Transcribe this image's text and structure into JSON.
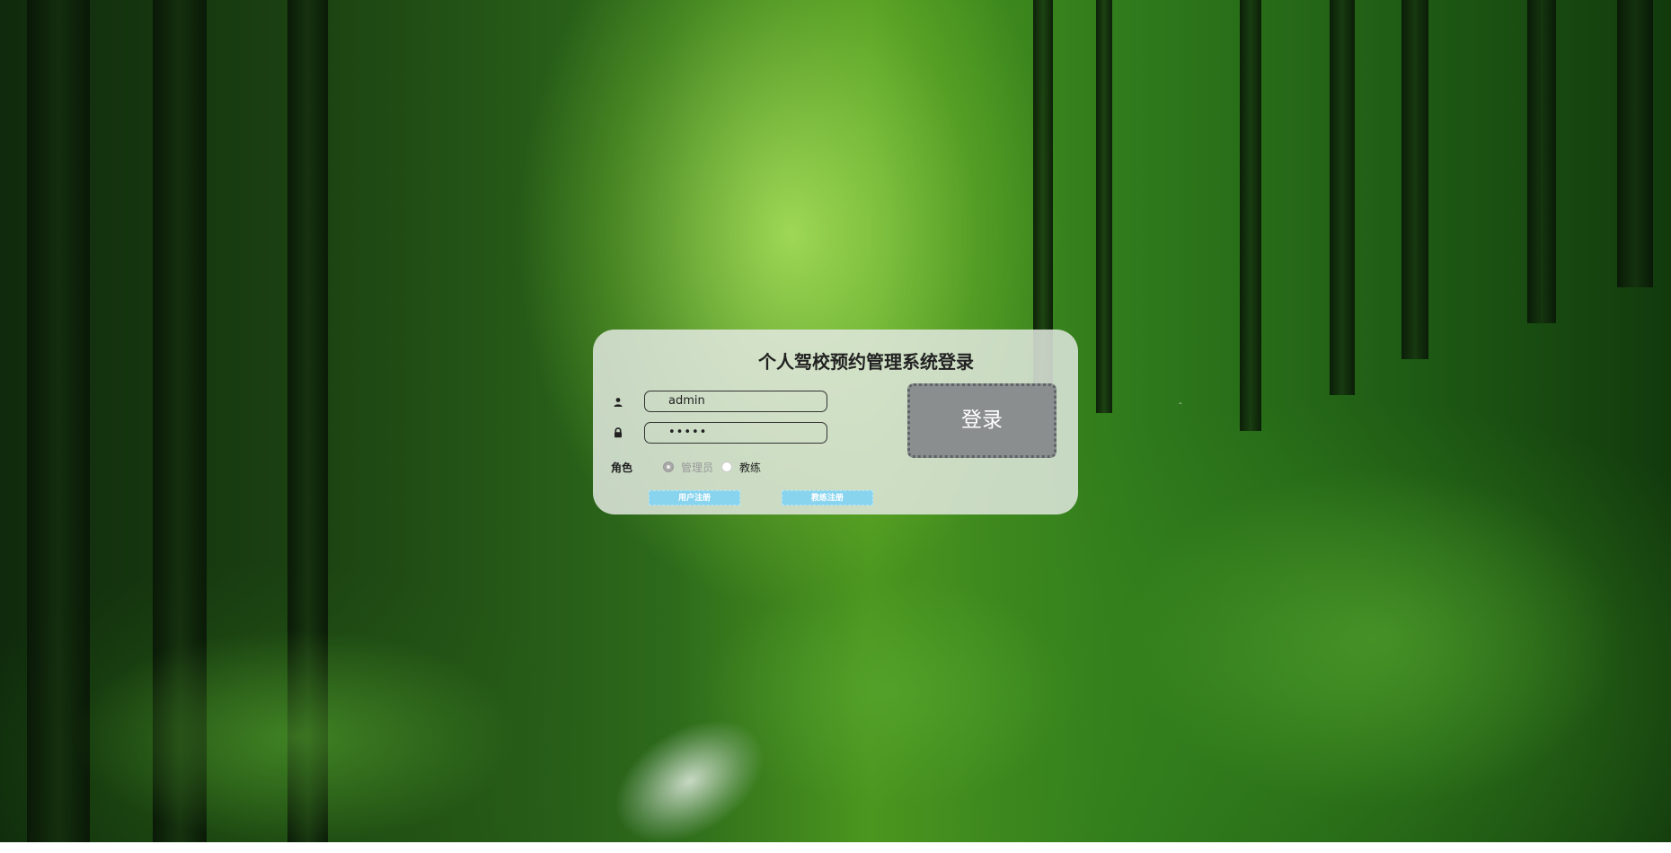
{
  "login": {
    "title": "个人驾校预约管理系统登录",
    "username_value": "admin",
    "password_value": "•••••",
    "role_label": "角色",
    "role_options": [
      "管理员",
      "教练"
    ],
    "role_selected": "管理员",
    "user_register_label": "用户注册",
    "coach_register_label": "教练注册",
    "login_button_label": "登录"
  },
  "background": {
    "mark_text": "-"
  },
  "icons": {
    "username": "user-icon",
    "password": "lock-icon"
  },
  "colors": {
    "panel_bg": "#e1e8de",
    "login_button": "#8b8e8f",
    "register_button": "#88d4ef"
  }
}
